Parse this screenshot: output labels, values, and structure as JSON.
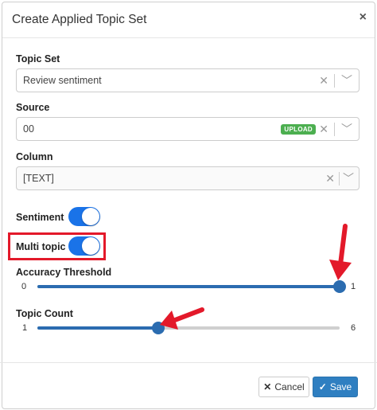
{
  "dialog": {
    "title": "Create Applied Topic Set",
    "close_icon": "×"
  },
  "topic_set": {
    "label": "Topic Set",
    "value": "Review sentiment"
  },
  "source": {
    "label": "Source",
    "value": "00",
    "badge": "UPLOAD"
  },
  "column": {
    "label": "Column",
    "value": "[TEXT]"
  },
  "sentiment": {
    "label": "Sentiment",
    "on": true
  },
  "multi_topic": {
    "label": "Multi topic",
    "on": true
  },
  "accuracy_threshold": {
    "label": "Accuracy Threshold",
    "min": "0",
    "max": "1",
    "value": 1
  },
  "topic_count": {
    "label": "Topic Count",
    "min": "1",
    "max": "6",
    "value": 3
  },
  "footer": {
    "cancel_label": "Cancel",
    "save_label": "Save"
  },
  "colors": {
    "accent": "#2f7fc1",
    "toggle_on": "#1a73e8",
    "annotation": "#e3192a",
    "badge": "#4caf50"
  }
}
